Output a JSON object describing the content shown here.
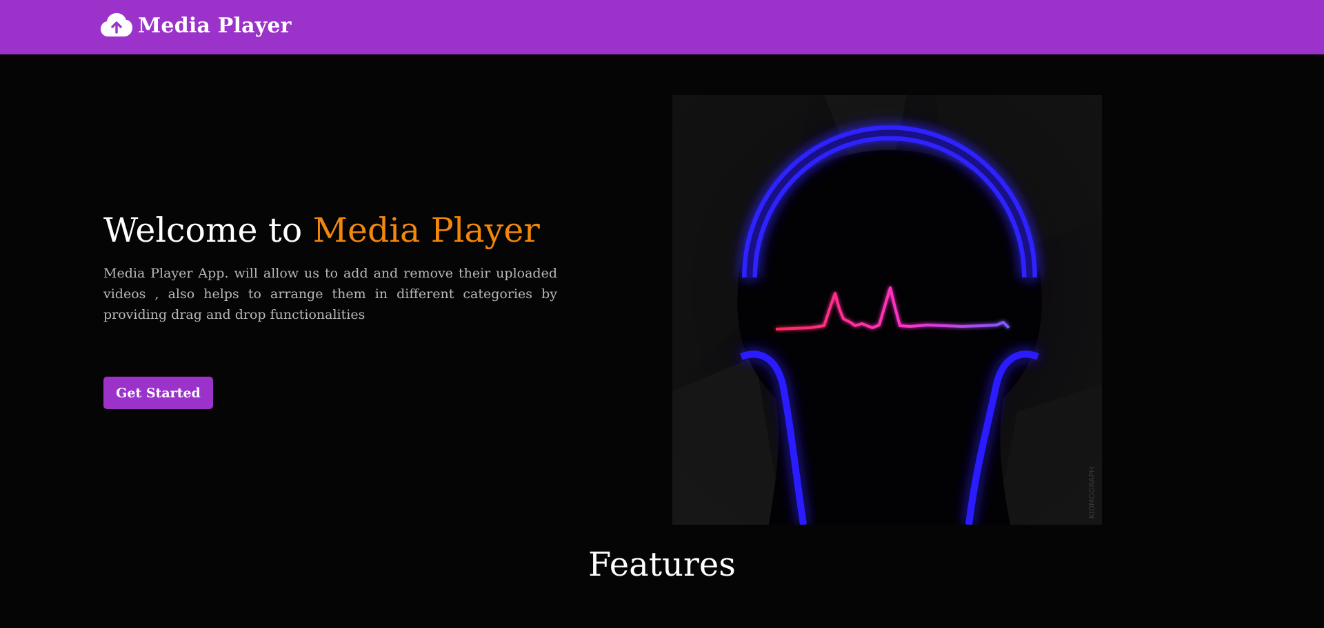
{
  "navbar": {
    "brand_icon": "cloud-upload-icon",
    "brand_name": "Media Player",
    "color": "#9b33cb"
  },
  "hero": {
    "title_prefix": "Welcome to ",
    "title_accent": "Media Player",
    "accent_color": "#f2870c",
    "description": "Media Player App. will allow us to add and remove their uploaded videos , also helps to arrange them in different categories by providing drag and drop functionalities",
    "cta_label": "Get Started",
    "image": "headphones-heartbeat-illustration",
    "image_watermark": "KIDMOGRAPH"
  },
  "features": {
    "title": "Features"
  }
}
